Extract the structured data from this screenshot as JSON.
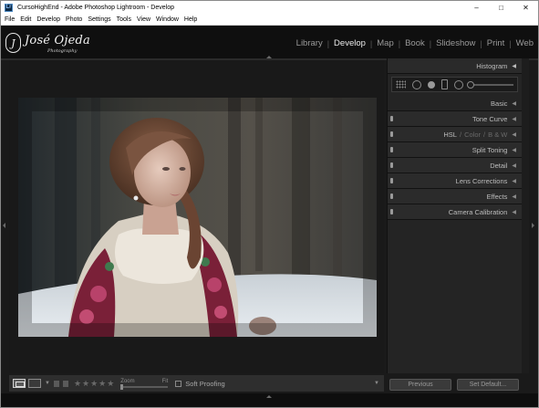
{
  "window": {
    "title": "CursoHighEnd - Adobe Photoshop Lightroom - Develop",
    "app_icon": "Lr",
    "controls": [
      "–",
      "□",
      "✕"
    ]
  },
  "menu": [
    "File",
    "Edit",
    "Develop",
    "Photo",
    "Settings",
    "Tools",
    "View",
    "Window",
    "Help"
  ],
  "identity_plate": {
    "monogram": "J",
    "name": "José Ojeda",
    "subtitle": "Photography"
  },
  "modules": [
    {
      "label": "Library",
      "active": false
    },
    {
      "label": "Develop",
      "active": true
    },
    {
      "label": "Map",
      "active": false
    },
    {
      "label": "Book",
      "active": false
    },
    {
      "label": "Slideshow",
      "active": false
    },
    {
      "label": "Print",
      "active": false
    },
    {
      "label": "Web",
      "active": false
    }
  ],
  "right_panel": {
    "histogram_label": "Histogram",
    "sections": [
      "Basic",
      "Tone Curve",
      "HSL",
      "Split Toning",
      "Detail",
      "Lens Corrections",
      "Effects",
      "Camera Calibration"
    ],
    "hsl_tabs": [
      "HSL",
      "Color",
      "B & W"
    ]
  },
  "toolbar": {
    "stars": "★★★★★",
    "zoom_label": "Zoom",
    "zoom_fit": "Fit",
    "soft_proofing_label": "Soft Proofing"
  },
  "buttons": {
    "previous": "Previous",
    "set_default": "Set Default..."
  },
  "icons": {
    "collapse_triangle": "triangle-left-icon",
    "panel_switch": "switch-icon"
  }
}
